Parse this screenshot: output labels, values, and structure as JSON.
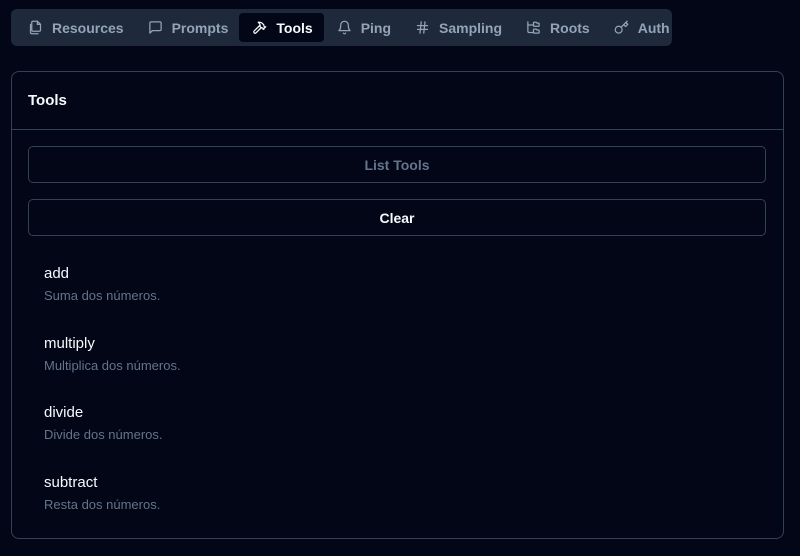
{
  "tabs": [
    {
      "label": "Resources",
      "icon": "files-icon",
      "active": false
    },
    {
      "label": "Prompts",
      "icon": "message-square-icon",
      "active": false
    },
    {
      "label": "Tools",
      "icon": "hammer-icon",
      "active": true
    },
    {
      "label": "Ping",
      "icon": "bell-icon",
      "active": false
    },
    {
      "label": "Sampling",
      "icon": "hash-icon",
      "active": false
    },
    {
      "label": "Roots",
      "icon": "folder-tree-icon",
      "active": false
    },
    {
      "label": "Auth",
      "icon": "key-icon",
      "active": false
    }
  ],
  "panel": {
    "title": "Tools",
    "list_button": "List Tools",
    "clear_button": "Clear"
  },
  "tools": [
    {
      "name": "add",
      "description": "Suma dos números."
    },
    {
      "name": "multiply",
      "description": "Multiplica dos números."
    },
    {
      "name": "divide",
      "description": "Divide dos números."
    },
    {
      "name": "subtract",
      "description": "Resta dos números."
    }
  ],
  "colors": {
    "background": "#020617",
    "tabbar": "#1e293b",
    "border": "#334155",
    "muted_text": "#64748b",
    "tab_text": "#94a3b8",
    "text": "#f8fafc"
  }
}
